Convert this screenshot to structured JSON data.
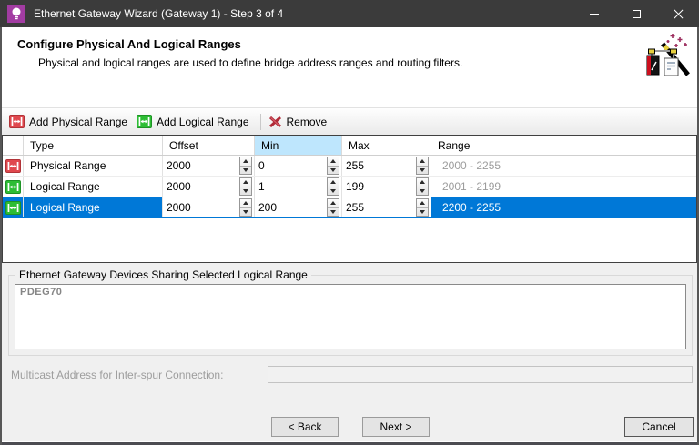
{
  "window": {
    "title": "Ethernet Gateway Wizard (Gateway 1) - Step 3 of 4"
  },
  "header": {
    "title": "Configure Physical And Logical Ranges",
    "description": "Physical and logical ranges are used to define bridge address ranges and routing filters."
  },
  "toolbar": {
    "add_physical_label": "Add Physical Range",
    "add_logical_label": "Add Logical Range",
    "remove_label": "Remove"
  },
  "table": {
    "columns": [
      "Type",
      "Offset",
      "Min",
      "Max",
      "Range"
    ],
    "highlighted_column": "Min",
    "rows": [
      {
        "type": "Physical Range",
        "icon": "physical-range-icon",
        "offset": "2000",
        "min": "0",
        "max": "255",
        "range": "2000 - 2255",
        "selected": false
      },
      {
        "type": "Logical Range",
        "icon": "logical-range-icon",
        "offset": "2000",
        "min": "1",
        "max": "199",
        "range": "2001 - 2199",
        "selected": false
      },
      {
        "type": "Logical Range",
        "icon": "logical-range-icon",
        "offset": "2000",
        "min": "200",
        "max": "255",
        "range": "2200 - 2255",
        "selected": true
      }
    ]
  },
  "group_box": {
    "title": "Ethernet Gateway Devices Sharing Selected Logical Range",
    "devices": [
      "PDEG70"
    ]
  },
  "multicast": {
    "label": "Multicast Address for Inter-spur Connection:",
    "value": "",
    "disabled": true
  },
  "footer": {
    "back_label": "< Back",
    "next_label": "Next >",
    "cancel_label": "Cancel"
  },
  "icons": {
    "app": "lightbulb-icon",
    "header_art": "magic-wand-icon",
    "add_physical": "physical-range-icon",
    "add_logical": "logical-range-icon",
    "remove": "remove-x-icon",
    "numeric_cells": "spin-up-down-icon"
  },
  "colors": {
    "titlebar": "#3b3b3b",
    "app_icon": "#a23ca2",
    "selection": "#0078d7",
    "min_header_highlight": "#bee6fd",
    "physical_icon": "#e0484e",
    "logical_icon": "#2dbd34",
    "disabled_text": "#9d9d9d"
  }
}
